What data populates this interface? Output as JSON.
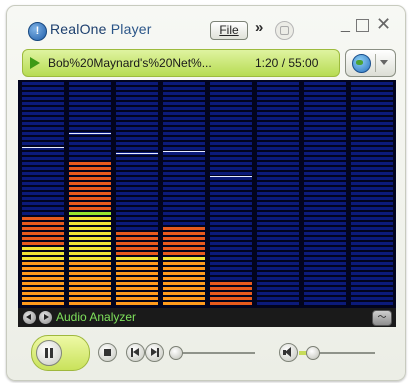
{
  "window": {
    "app_name_main": "RealOne",
    "app_name_suffix": " Player",
    "logo_glyph": "!",
    "menu_button_label": "File",
    "chevron_label": "»",
    "minimize_glyph": "_",
    "close_glyph": "✕"
  },
  "now_playing": {
    "track": "Bob%20Maynard's%20Net%...",
    "time": "1:20 / 55:00",
    "state": "playing"
  },
  "visualization": {
    "name": "Audio Analyzer",
    "options_glyph": "〜",
    "bands": [
      {
        "level": 0.39,
        "peak": 0.7
      },
      {
        "level": 0.65,
        "peak": 0.76
      },
      {
        "level": 0.34,
        "peak": 0.67
      },
      {
        "level": 0.36,
        "peak": 0.68
      },
      {
        "level": 0.1,
        "peak": 0.57
      },
      {
        "level": 0,
        "peak": 0
      },
      {
        "level": 0,
        "peak": 0
      },
      {
        "level": 0,
        "peak": 0
      }
    ],
    "colors": {
      "background": "#02041e",
      "unlit": "#0b1a7a",
      "low": "#e85a1c",
      "mid": "#ff9a1c",
      "high": "#f1e334",
      "top": "#97e52c"
    }
  },
  "controls": {
    "seek_position": 0.02,
    "volume": 0.17
  },
  "icons": [
    "realone-logo-icon",
    "security-shield-icon",
    "play-indicator-icon",
    "globe-icon",
    "dropdown-arrow-icon",
    "prev-visualization-icon",
    "next-visualization-icon",
    "visualization-options-icon",
    "pause-icon",
    "stop-icon",
    "previous-track-icon",
    "next-track-icon",
    "volume-icon"
  ],
  "theme": {
    "accent": "#c9e25b",
    "title_color": "#1c3f6e"
  }
}
